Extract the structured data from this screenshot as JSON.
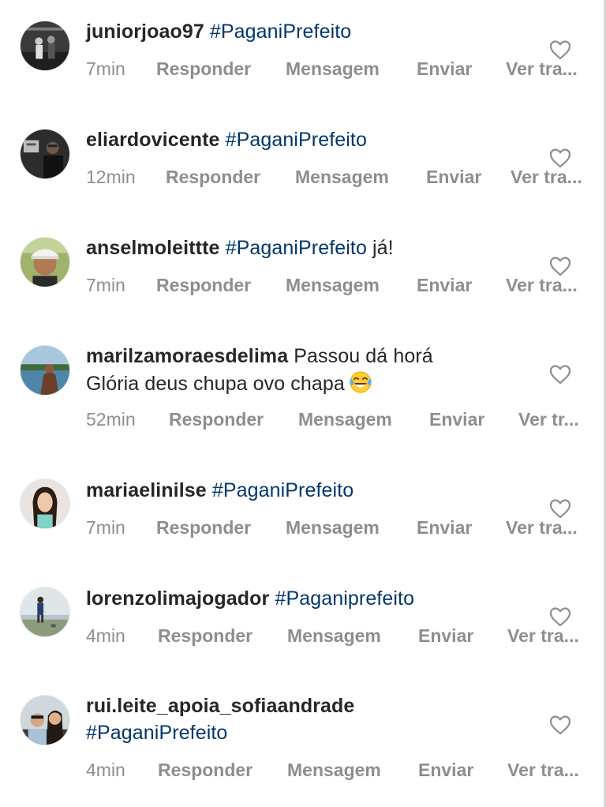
{
  "comments": [
    {
      "username": "juniorjoao97",
      "body_hashtag": "#PaganiPrefeito",
      "body_text": "",
      "time": "7min",
      "reply_label": "Responder",
      "message_label": "Mensagem",
      "send_label": "Enviar",
      "translate_label": "Ver tra..."
    },
    {
      "username": "eliardovicente",
      "body_hashtag": "#PaganiPrefeito",
      "body_text": "",
      "time": "12min",
      "reply_label": "Responder",
      "message_label": "Mensagem",
      "send_label": "Enviar",
      "translate_label": "Ver tra..."
    },
    {
      "username": "anselmoleittte",
      "body_hashtag": "#PaganiPrefeito",
      "body_text": " já!",
      "time": "7min",
      "reply_label": "Responder",
      "message_label": "Mensagem",
      "send_label": "Enviar",
      "translate_label": "Ver tra..."
    },
    {
      "username": "marilzamoraesdelima",
      "body_line1": "Passou dá horá",
      "body_line2": "Glória deus chupa ovo chapa",
      "emoji": "face-with-tears-of-joy",
      "time": "52min",
      "reply_label": "Responder",
      "message_label": "Mensagem",
      "send_label": "Enviar",
      "translate_label": "Ver tr..."
    },
    {
      "username": "mariaelinilse",
      "body_hashtag": "#PaganiPrefeito",
      "body_text": "",
      "time": "7min",
      "reply_label": "Responder",
      "message_label": "Mensagem",
      "send_label": "Enviar",
      "translate_label": "Ver tra..."
    },
    {
      "username": "lorenzolimajogador",
      "body_hashtag": "#Paganiprefeito",
      "body_text": "",
      "time": "4min",
      "reply_label": "Responder",
      "message_label": "Mensagem",
      "send_label": "Enviar",
      "translate_label": "Ver tra..."
    },
    {
      "username": "rui.leite_apoia_sofiaandrade",
      "body_hashtag": "#PaganiPrefeito",
      "body_text": "",
      "time": "4min",
      "reply_label": "Responder",
      "message_label": "Mensagem",
      "send_label": "Enviar",
      "translate_label": "Ver tra..."
    }
  ],
  "colors": {
    "username": "#262626",
    "hashtag": "#00376b",
    "meta": "#8e8e8e",
    "heart_outline": "#8e8e8e"
  },
  "icons": {
    "like": "heart-outline-icon",
    "emoji": "face-with-tears-of-joy"
  }
}
